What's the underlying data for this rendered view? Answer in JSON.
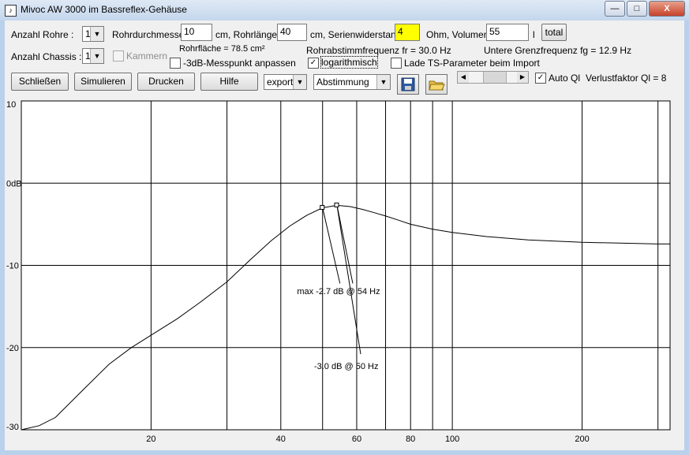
{
  "window": {
    "title": "Mivoc AW 3000 im Bassreflex-Gehäuse",
    "minimize": "—",
    "maximize": "□",
    "close": "X"
  },
  "row1": {
    "anzahl_rohre_label": "Anzahl Rohre :",
    "anzahl_rohre_value": "1",
    "rohrdurchmesser_label": "Rohrdurchmesser",
    "rohrdurchmesser_value": "10",
    "rohrlaenge_label": "cm, Rohrlänge",
    "rohrlaenge_value": "40",
    "serienwiderstand_label": "cm, Serienwiderstand",
    "serienwiderstand_value": "4",
    "volumen_label": "Ohm, Volumen",
    "volumen_value": "55",
    "volumen_unit": "l",
    "total_button": "total"
  },
  "row2": {
    "anzahl_chassis_label": "Anzahl Chassis :",
    "anzahl_chassis_value": "1",
    "kammern_label": "Kammern",
    "rohrflaeche": "Rohrfläche = 78.5 cm²",
    "messpunkt_label": "-3dB-Messpunkt anpassen",
    "rohrabstimm": "Rohrabstimmfrequenz fr = 30.0 Hz",
    "logarithmisch_label": "logarithmisch",
    "grenzfrequenz": "Untere Grenzfrequenz fg = 12.9 Hz",
    "lade_ts_label": "Lade TS-Parameter beim Import"
  },
  "toolbar": {
    "schliessen": "Schließen",
    "simulieren": "Simulieren",
    "drucken": "Drucken",
    "hilfe": "Hilfe",
    "export_value": "export",
    "abstimmung_value": "Abstimmung",
    "auto_ql_label": "Auto Ql",
    "verlustfaktor": "Verlustfaktor Ql = 8"
  },
  "chart_data": {
    "type": "line",
    "xscale": "log",
    "xlim": [
      10,
      320
    ],
    "ylim": [
      -30,
      10
    ],
    "y_ticks": [
      "10",
      "0dB",
      "-10",
      "-20",
      "-30"
    ],
    "x_ticks": [
      "20",
      "40",
      "60",
      "80",
      "100",
      "200"
    ],
    "x_grid": [
      20,
      30,
      40,
      50,
      60,
      70,
      80,
      90,
      100,
      200,
      300
    ],
    "y_grid": [
      10,
      0,
      -10,
      -20,
      -30
    ],
    "series": [
      {
        "x": [
          10,
          11,
          12,
          14,
          16,
          18,
          20,
          23,
          26,
          30,
          34,
          38,
          42,
          46,
          50,
          54,
          58,
          62,
          66,
          70,
          75,
          80,
          90,
          100,
          120,
          150,
          200,
          250,
          300,
          320
        ],
        "y": [
          -30,
          -29.5,
          -28.5,
          -25,
          -22,
          -20,
          -18.5,
          -16.5,
          -14.5,
          -12,
          -9.3,
          -7,
          -5.2,
          -3.9,
          -3.0,
          -2.7,
          -2.85,
          -3.2,
          -3.6,
          -4.0,
          -4.5,
          -5.0,
          -5.6,
          -6.0,
          -6.5,
          -6.9,
          -7.2,
          -7.3,
          -7.4,
          -7.4
        ]
      }
    ],
    "annotations": [
      {
        "text": "max -2.7 dB @ 54 Hz",
        "x": 54,
        "y": -2.7
      },
      {
        "text": "-3.0 dB @  50 Hz",
        "x": 50,
        "y": -3.0
      }
    ]
  }
}
